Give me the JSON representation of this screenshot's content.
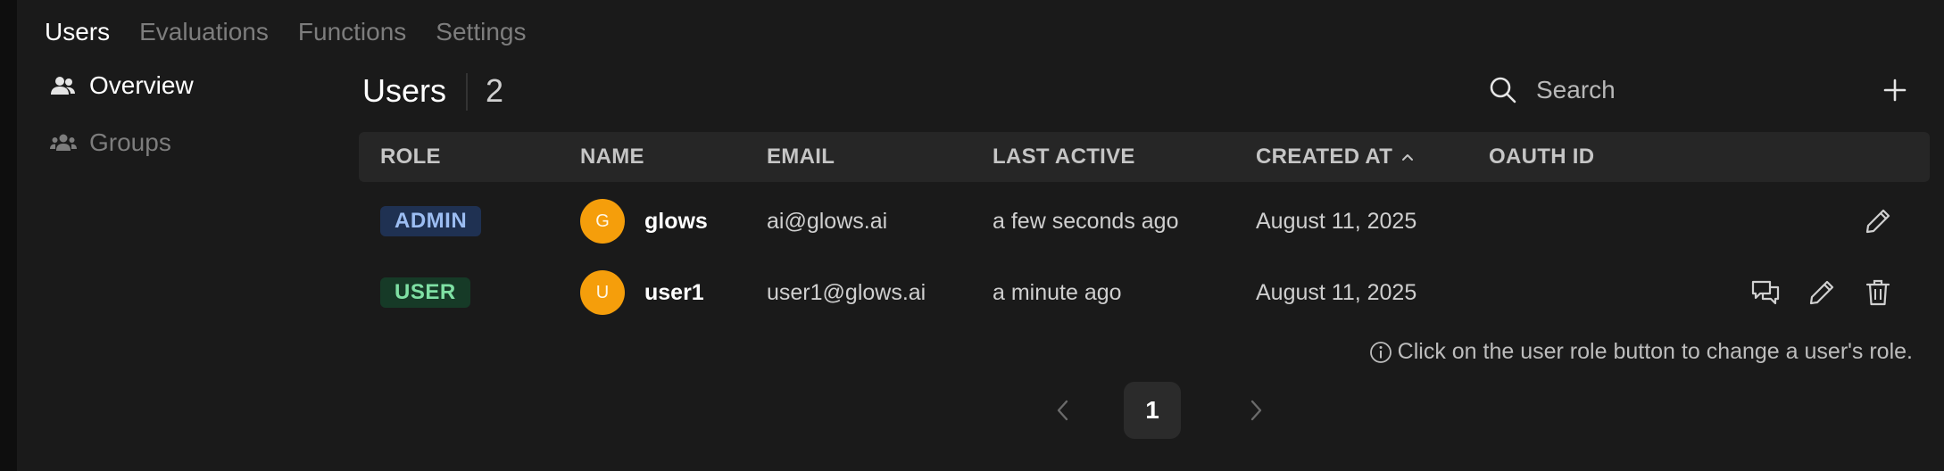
{
  "top_tabs": [
    {
      "label": "Users",
      "active": true
    },
    {
      "label": "Evaluations",
      "active": false
    },
    {
      "label": "Functions",
      "active": false
    },
    {
      "label": "Settings",
      "active": false
    }
  ],
  "sidebar": {
    "items": [
      {
        "label": "Overview",
        "icon": "users-icon",
        "active": true
      },
      {
        "label": "Groups",
        "icon": "groups-icon",
        "active": false
      }
    ]
  },
  "header": {
    "title": "Users",
    "count": "2",
    "search": {
      "placeholder": "Search",
      "value": ""
    },
    "add_icon": "plus-icon"
  },
  "table": {
    "columns": [
      "ROLE",
      "NAME",
      "EMAIL",
      "LAST ACTIVE",
      "CREATED AT",
      "OAUTH ID"
    ],
    "sorted_column": "CREATED AT",
    "sort_direction": "ascending",
    "rows": [
      {
        "role": "ADMIN",
        "avatar_initial": "G",
        "name": "glows",
        "email": "ai@glows.ai",
        "last_active": "a few seconds ago",
        "created_at": "August 11, 2025",
        "oauth_id": "",
        "actions": [
          "edit-icon"
        ]
      },
      {
        "role": "USER",
        "avatar_initial": "U",
        "name": "user1",
        "email": "user1@glows.ai",
        "last_active": "a minute ago",
        "created_at": "August 11, 2025",
        "oauth_id": "",
        "actions": [
          "chat-icon",
          "edit-icon",
          "trash-icon"
        ]
      }
    ]
  },
  "hint": "Click on the user role button to change a user's role.",
  "pagination": {
    "current_page": "1"
  },
  "colors": {
    "background": "#1a1a1a",
    "admin_badge_bg": "#1f3152",
    "admin_badge_text": "#9cbdf2",
    "user_badge_bg": "#163a27",
    "user_badge_text": "#7fe0a4",
    "avatar": "#f59e0b"
  }
}
